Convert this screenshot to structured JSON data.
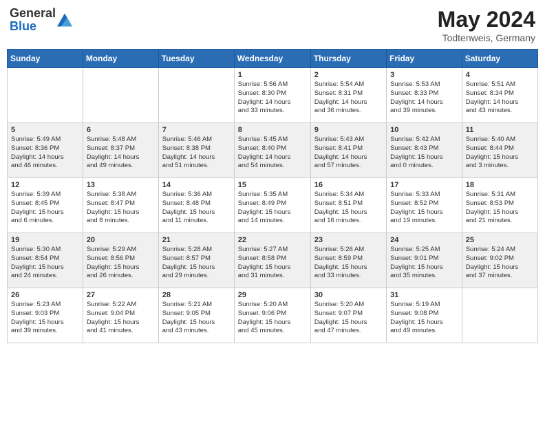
{
  "header": {
    "logo_general": "General",
    "logo_blue": "Blue",
    "month_year": "May 2024",
    "location": "Todtenweis, Germany"
  },
  "weekdays": [
    "Sunday",
    "Monday",
    "Tuesday",
    "Wednesday",
    "Thursday",
    "Friday",
    "Saturday"
  ],
  "weeks": [
    [
      {
        "day": "",
        "lines": []
      },
      {
        "day": "",
        "lines": []
      },
      {
        "day": "",
        "lines": []
      },
      {
        "day": "1",
        "lines": [
          "Sunrise: 5:56 AM",
          "Sunset: 8:30 PM",
          "Daylight: 14 hours",
          "and 33 minutes."
        ]
      },
      {
        "day": "2",
        "lines": [
          "Sunrise: 5:54 AM",
          "Sunset: 8:31 PM",
          "Daylight: 14 hours",
          "and 36 minutes."
        ]
      },
      {
        "day": "3",
        "lines": [
          "Sunrise: 5:53 AM",
          "Sunset: 8:33 PM",
          "Daylight: 14 hours",
          "and 39 minutes."
        ]
      },
      {
        "day": "4",
        "lines": [
          "Sunrise: 5:51 AM",
          "Sunset: 8:34 PM",
          "Daylight: 14 hours",
          "and 43 minutes."
        ]
      }
    ],
    [
      {
        "day": "5",
        "lines": [
          "Sunrise: 5:49 AM",
          "Sunset: 8:36 PM",
          "Daylight: 14 hours",
          "and 46 minutes."
        ]
      },
      {
        "day": "6",
        "lines": [
          "Sunrise: 5:48 AM",
          "Sunset: 8:37 PM",
          "Daylight: 14 hours",
          "and 49 minutes."
        ]
      },
      {
        "day": "7",
        "lines": [
          "Sunrise: 5:46 AM",
          "Sunset: 8:38 PM",
          "Daylight: 14 hours",
          "and 51 minutes."
        ]
      },
      {
        "day": "8",
        "lines": [
          "Sunrise: 5:45 AM",
          "Sunset: 8:40 PM",
          "Daylight: 14 hours",
          "and 54 minutes."
        ]
      },
      {
        "day": "9",
        "lines": [
          "Sunrise: 5:43 AM",
          "Sunset: 8:41 PM",
          "Daylight: 14 hours",
          "and 57 minutes."
        ]
      },
      {
        "day": "10",
        "lines": [
          "Sunrise: 5:42 AM",
          "Sunset: 8:43 PM",
          "Daylight: 15 hours",
          "and 0 minutes."
        ]
      },
      {
        "day": "11",
        "lines": [
          "Sunrise: 5:40 AM",
          "Sunset: 8:44 PM",
          "Daylight: 15 hours",
          "and 3 minutes."
        ]
      }
    ],
    [
      {
        "day": "12",
        "lines": [
          "Sunrise: 5:39 AM",
          "Sunset: 8:45 PM",
          "Daylight: 15 hours",
          "and 6 minutes."
        ]
      },
      {
        "day": "13",
        "lines": [
          "Sunrise: 5:38 AM",
          "Sunset: 8:47 PM",
          "Daylight: 15 hours",
          "and 8 minutes."
        ]
      },
      {
        "day": "14",
        "lines": [
          "Sunrise: 5:36 AM",
          "Sunset: 8:48 PM",
          "Daylight: 15 hours",
          "and 11 minutes."
        ]
      },
      {
        "day": "15",
        "lines": [
          "Sunrise: 5:35 AM",
          "Sunset: 8:49 PM",
          "Daylight: 15 hours",
          "and 14 minutes."
        ]
      },
      {
        "day": "16",
        "lines": [
          "Sunrise: 5:34 AM",
          "Sunset: 8:51 PM",
          "Daylight: 15 hours",
          "and 16 minutes."
        ]
      },
      {
        "day": "17",
        "lines": [
          "Sunrise: 5:33 AM",
          "Sunset: 8:52 PM",
          "Daylight: 15 hours",
          "and 19 minutes."
        ]
      },
      {
        "day": "18",
        "lines": [
          "Sunrise: 5:31 AM",
          "Sunset: 8:53 PM",
          "Daylight: 15 hours",
          "and 21 minutes."
        ]
      }
    ],
    [
      {
        "day": "19",
        "lines": [
          "Sunrise: 5:30 AM",
          "Sunset: 8:54 PM",
          "Daylight: 15 hours",
          "and 24 minutes."
        ]
      },
      {
        "day": "20",
        "lines": [
          "Sunrise: 5:29 AM",
          "Sunset: 8:56 PM",
          "Daylight: 15 hours",
          "and 26 minutes."
        ]
      },
      {
        "day": "21",
        "lines": [
          "Sunrise: 5:28 AM",
          "Sunset: 8:57 PM",
          "Daylight: 15 hours",
          "and 29 minutes."
        ]
      },
      {
        "day": "22",
        "lines": [
          "Sunrise: 5:27 AM",
          "Sunset: 8:58 PM",
          "Daylight: 15 hours",
          "and 31 minutes."
        ]
      },
      {
        "day": "23",
        "lines": [
          "Sunrise: 5:26 AM",
          "Sunset: 8:59 PM",
          "Daylight: 15 hours",
          "and 33 minutes."
        ]
      },
      {
        "day": "24",
        "lines": [
          "Sunrise: 5:25 AM",
          "Sunset: 9:01 PM",
          "Daylight: 15 hours",
          "and 35 minutes."
        ]
      },
      {
        "day": "25",
        "lines": [
          "Sunrise: 5:24 AM",
          "Sunset: 9:02 PM",
          "Daylight: 15 hours",
          "and 37 minutes."
        ]
      }
    ],
    [
      {
        "day": "26",
        "lines": [
          "Sunrise: 5:23 AM",
          "Sunset: 9:03 PM",
          "Daylight: 15 hours",
          "and 39 minutes."
        ]
      },
      {
        "day": "27",
        "lines": [
          "Sunrise: 5:22 AM",
          "Sunset: 9:04 PM",
          "Daylight: 15 hours",
          "and 41 minutes."
        ]
      },
      {
        "day": "28",
        "lines": [
          "Sunrise: 5:21 AM",
          "Sunset: 9:05 PM",
          "Daylight: 15 hours",
          "and 43 minutes."
        ]
      },
      {
        "day": "29",
        "lines": [
          "Sunrise: 5:20 AM",
          "Sunset: 9:06 PM",
          "Daylight: 15 hours",
          "and 45 minutes."
        ]
      },
      {
        "day": "30",
        "lines": [
          "Sunrise: 5:20 AM",
          "Sunset: 9:07 PM",
          "Daylight: 15 hours",
          "and 47 minutes."
        ]
      },
      {
        "day": "31",
        "lines": [
          "Sunrise: 5:19 AM",
          "Sunset: 9:08 PM",
          "Daylight: 15 hours",
          "and 49 minutes."
        ]
      },
      {
        "day": "",
        "lines": []
      }
    ]
  ]
}
